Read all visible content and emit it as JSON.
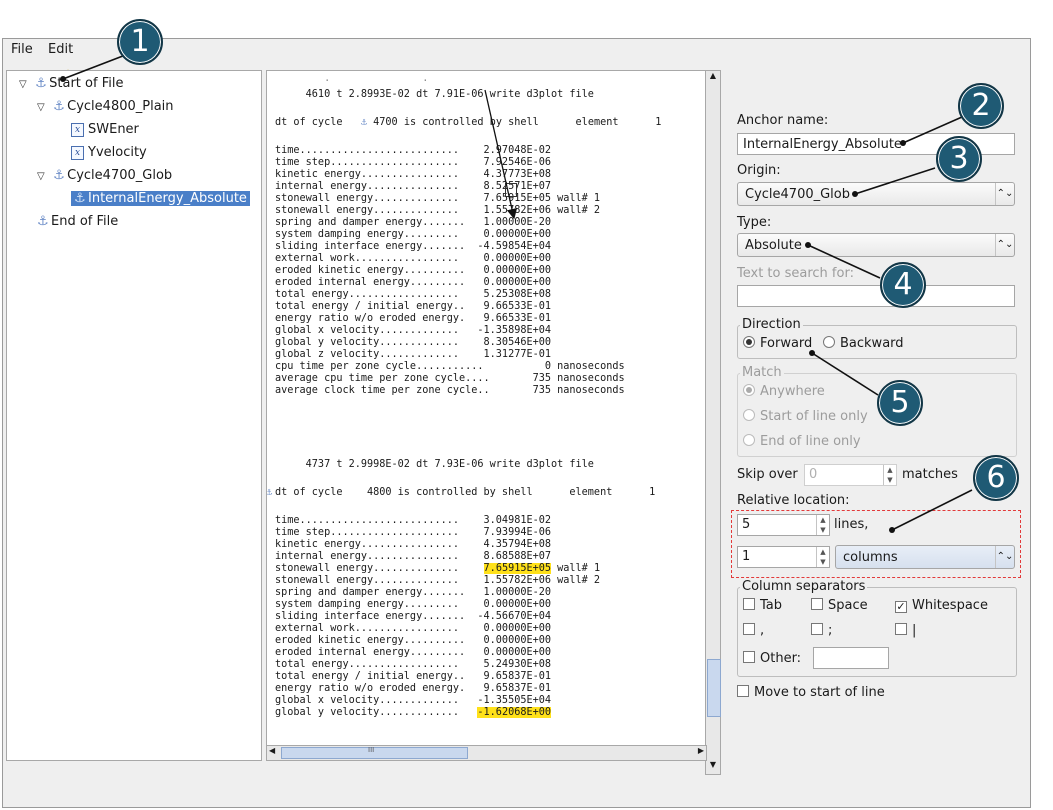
{
  "menu": [
    "File",
    "Edit"
  ],
  "toolbar": {
    "icons": [
      "add-expression-icon",
      "add-anchor-icon",
      "delete-icon"
    ]
  },
  "tree": {
    "items": [
      {
        "label": "Start of File",
        "icon": "anchor-icon",
        "expanded": true
      },
      {
        "label": "Cycle4800_Plain",
        "icon": "anchor-icon",
        "expanded": true
      },
      {
        "label": "SWEner",
        "icon": "expression-icon"
      },
      {
        "label": "Yvelocity",
        "icon": "expression-icon"
      },
      {
        "label": "Cycle4700_Glob",
        "icon": "anchor-icon",
        "expanded": true
      },
      {
        "label": "InternalEnergy_Absolute",
        "icon": "anchor-icon",
        "selected": true
      },
      {
        "label": "End of File",
        "icon": "anchor-icon"
      }
    ]
  },
  "log": {
    "line_a1": "     4610 t 2.8993E-02 dt 7.91E-06 write d3plot file",
    "line_a2": "dt of cycle   ",
    "line_a2b": " 4700 is controlled by shell      element      1",
    "block1": [
      "time..........................    2.97048E-02",
      "time step.....................    7.92546E-06",
      "kinetic energy................    4.37773E+08",
      "internal energy...............    8.52571E+07",
      "stonewall energy..............    7.65915E+05 wall# 1",
      "stonewall energy..............    1.55782E+06 wall# 2",
      "spring and damper energy.......   1.00000E-20",
      "system damping energy.........    0.00000E+00",
      "sliding interface energy.......  -4.59854E+04",
      "external work.................    0.00000E+00",
      "eroded kinetic energy..........   0.00000E+00",
      "eroded internal energy.........   0.00000E+00",
      "total energy..................    5.25308E+08",
      "total energy / initial energy..   9.66533E-01",
      "energy ratio w/o eroded energy.   9.66533E-01",
      "global x velocity.............   -1.35898E+04",
      "global y velocity.............    8.30546E+00",
      "global z velocity.............    1.31277E-01",
      "cpu time per zone cycle...........          0 nanoseconds",
      "average cpu time per zone cycle....       735 nanoseconds",
      "average clock time per zone cycle..       735 nanoseconds"
    ],
    "line_b1": "     4737 t 2.9998E-02 dt 7.93E-06 write d3plot file",
    "line_b2": "dt of cycle    4800 is controlled by shell      element      1",
    "block2": [
      "time..........................    3.04981E-02",
      "time step.....................    7.93994E-06",
      "kinetic energy................    4.35794E+08",
      "internal energy...............    8.68588E+07",
      "stonewall energy..............    7.65915E+05 wall# 1",
      "stonewall energy..............    1.55782E+06 wall# 2",
      "spring and damper energy.......   1.00000E-20",
      "system damping energy.........    0.00000E+00",
      "sliding interface energy.......  -4.56670E+04",
      "external work.................    0.00000E+00",
      "eroded kinetic energy..........   0.00000E+00",
      "eroded internal energy.........   0.00000E+00",
      "total energy..................    5.24930E+08",
      "total energy / initial energy..   9.65837E-01",
      "energy ratio w/o eroded energy.   9.65837E-01",
      "global x velocity.............   -1.35505E+04",
      "global y velocity.............   -1.62068E+00"
    ],
    "hscroll_mark": "III"
  },
  "panel": {
    "anchor_name_label": "Anchor name:",
    "anchor_name_value": "InternalEnergy_Absolute",
    "origin_label": "Origin:",
    "origin_value": "Cycle4700_Glob",
    "type_label": "Type:",
    "type_value": "Absolute",
    "search_label": "Text to search for:",
    "search_value": "",
    "direction_title": "Direction",
    "forward": "Forward",
    "backward": "Backward",
    "match_title": "Match",
    "match_options": [
      "Anywhere",
      "Start of line only",
      "End of line only"
    ],
    "skip_over_label": "Skip over",
    "skip_over_value": "0",
    "matches_label": "matches",
    "relative_location_label": "Relative location:",
    "lines_value": "5",
    "lines_label": "lines,",
    "columns_value": "1",
    "columns_unit": "columns",
    "column_sep_title": "Column separators",
    "sep_tab": "Tab",
    "sep_space": "Space",
    "sep_whitespace": "Whitespace",
    "sep_comma": ",",
    "sep_semicolon": ";",
    "sep_pipe": "|",
    "sep_other": "Other:",
    "sep_other_value": "",
    "move_to_start": "Move to start of line"
  },
  "callouts": [
    "1",
    "2",
    "3",
    "4",
    "5",
    "6"
  ],
  "colors": {
    "callout": "#1f5a74",
    "highlight": "#ffe11a",
    "selection": "#4a7fc8",
    "dashed": "#e23a3a"
  }
}
